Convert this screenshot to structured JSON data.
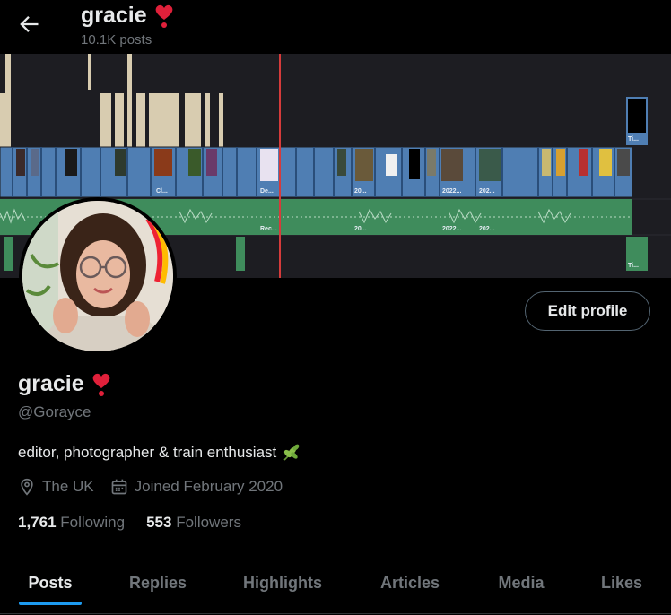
{
  "header": {
    "back_label": "back",
    "name": "gracie",
    "posts_count": "10.1K posts"
  },
  "banner": {
    "clip_labels": [
      "Cl...",
      "De...",
      "20...",
      "2022...",
      "202...",
      "Ti...",
      "Rec...",
      "20...",
      "2022...",
      "202...",
      "Ti..."
    ]
  },
  "profile": {
    "edit_button": "Edit profile",
    "name": "gracie",
    "handle": "@Gorayce",
    "bio": "editor, photographer & train enthusiast",
    "location": "The UK",
    "joined": "Joined February 2020",
    "following_count": "1,761",
    "following_label": "Following",
    "followers_count": "553",
    "followers_label": "Followers"
  },
  "tabs": [
    {
      "label": "Posts",
      "active": true
    },
    {
      "label": "Replies",
      "active": false
    },
    {
      "label": "Highlights",
      "active": false
    },
    {
      "label": "Articles",
      "active": false
    },
    {
      "label": "Media",
      "active": false
    },
    {
      "label": "Likes",
      "active": false
    }
  ],
  "colors": {
    "accent": "#1d9bf0",
    "heart": "#f91880",
    "video_track": "#4a77a8",
    "audio_track": "#3f8c5c",
    "playhead": "#d63b3b"
  }
}
